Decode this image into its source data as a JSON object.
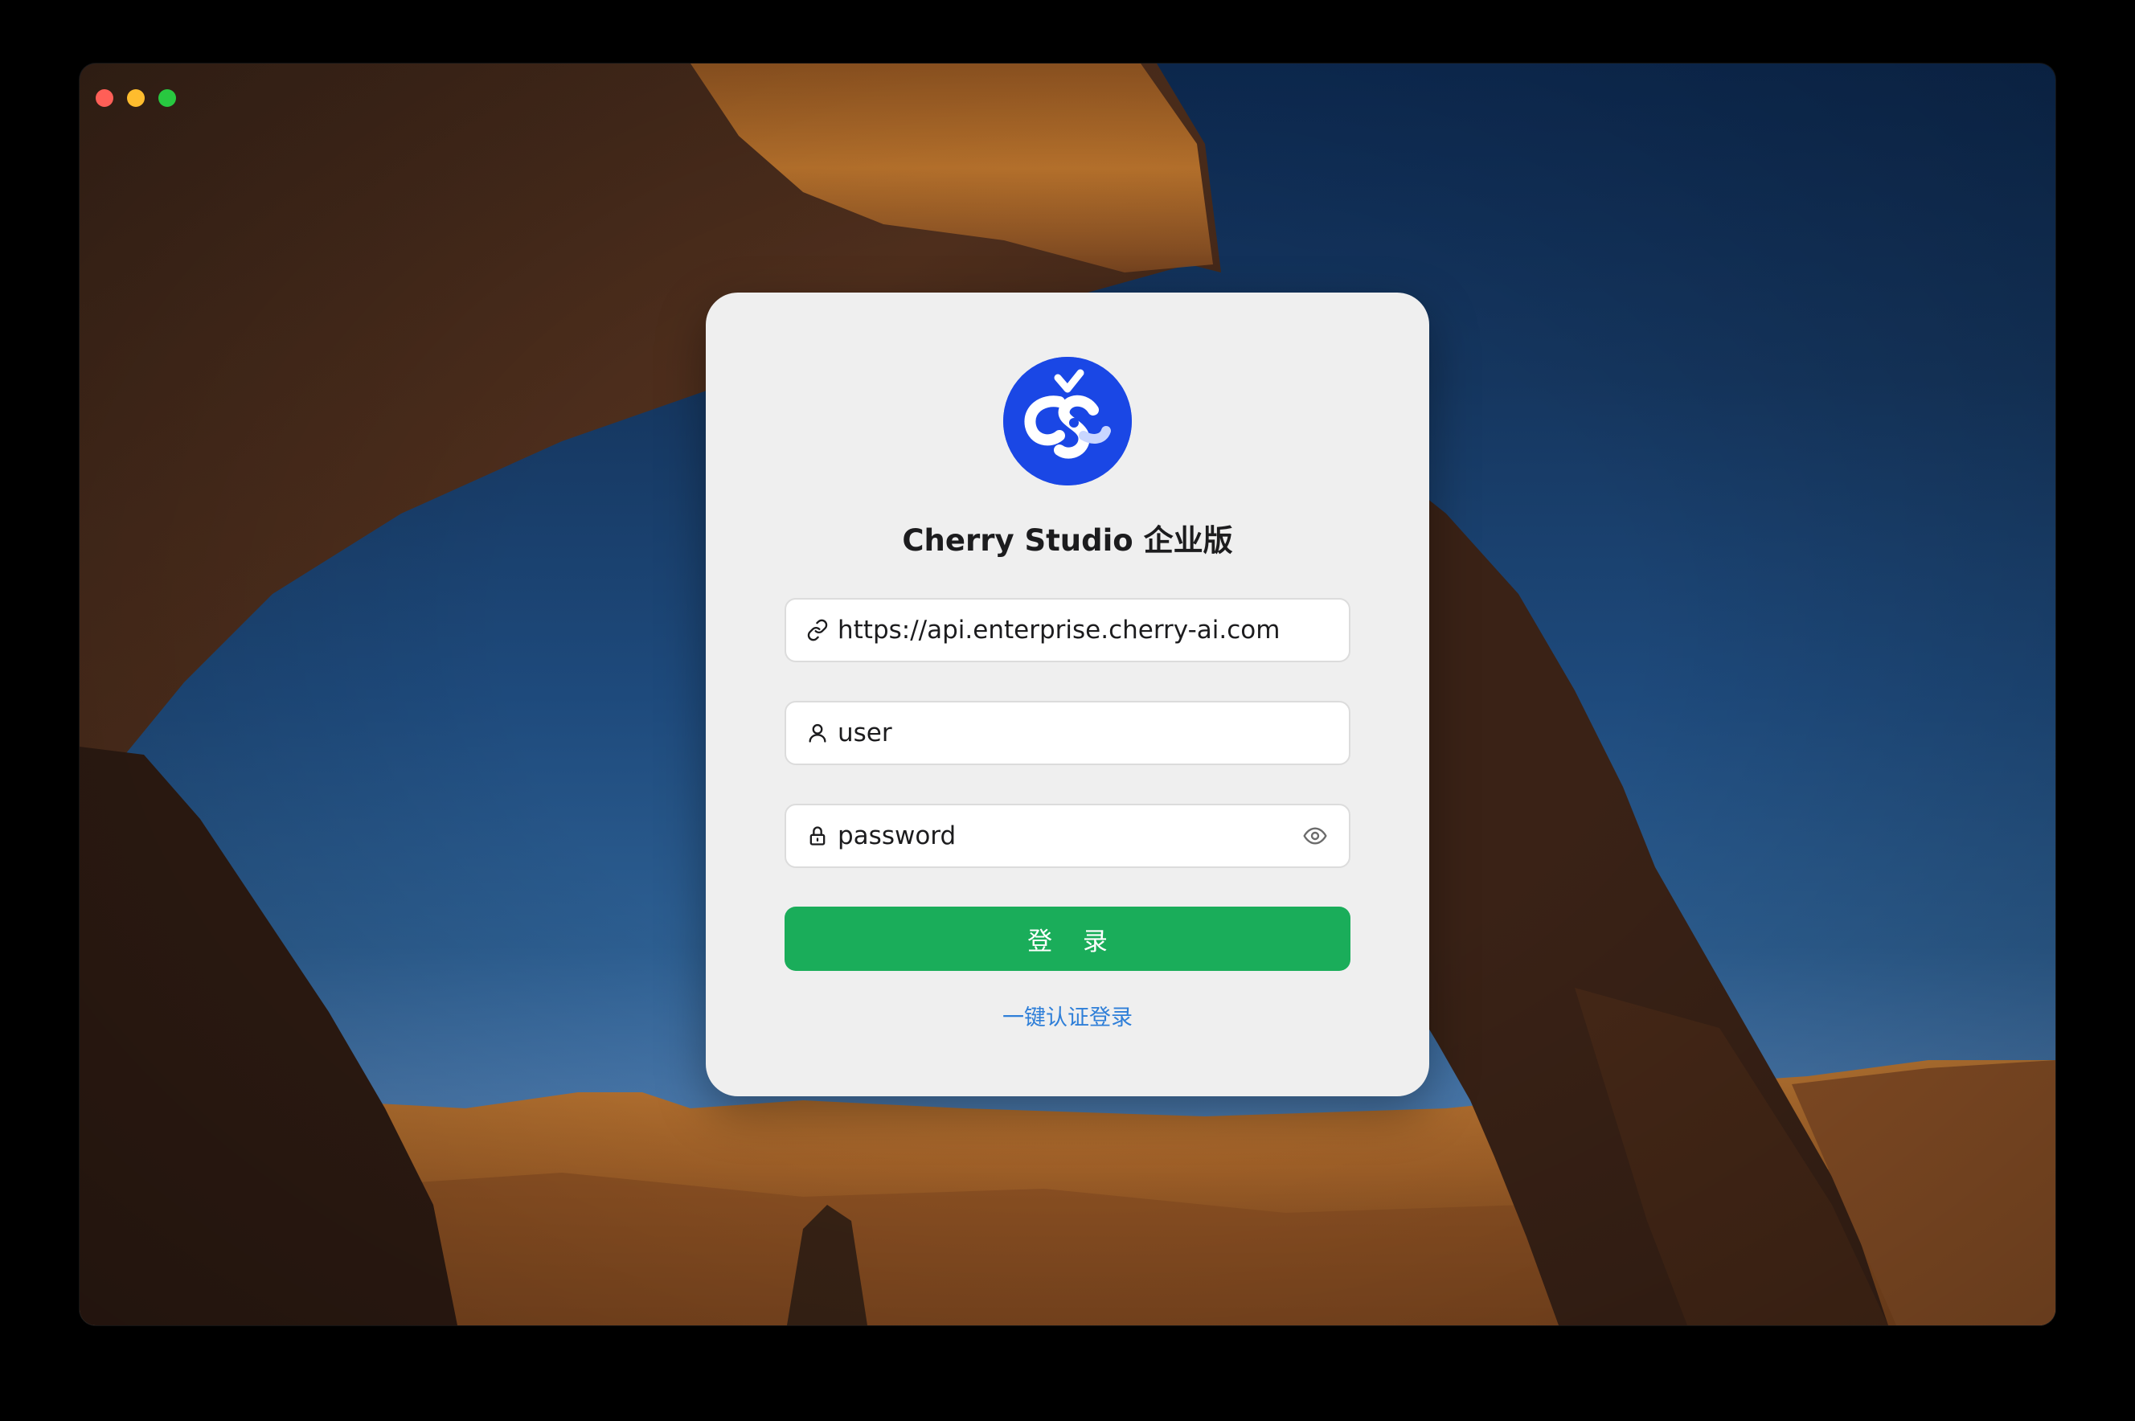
{
  "window": {
    "controls": [
      "close",
      "minimize",
      "zoom"
    ]
  },
  "login": {
    "title": "Cherry Studio 企业版",
    "logo_icon": "cherry-studio-logo",
    "server_field": {
      "icon": "link-icon",
      "value": "https://api.enterprise.cherry-ai.com"
    },
    "username_field": {
      "icon": "user-icon",
      "value": "user"
    },
    "password_field": {
      "icon": "lock-icon",
      "placeholder": "password",
      "toggle_icon": "eye-icon"
    },
    "login_button": "登 录",
    "sso_link": "一键认证登录"
  },
  "colors": {
    "primary_button": "#1aad5a",
    "link": "#2f7fd8",
    "logo_bg": "#1a47e5",
    "card_bg": "#efefef"
  }
}
